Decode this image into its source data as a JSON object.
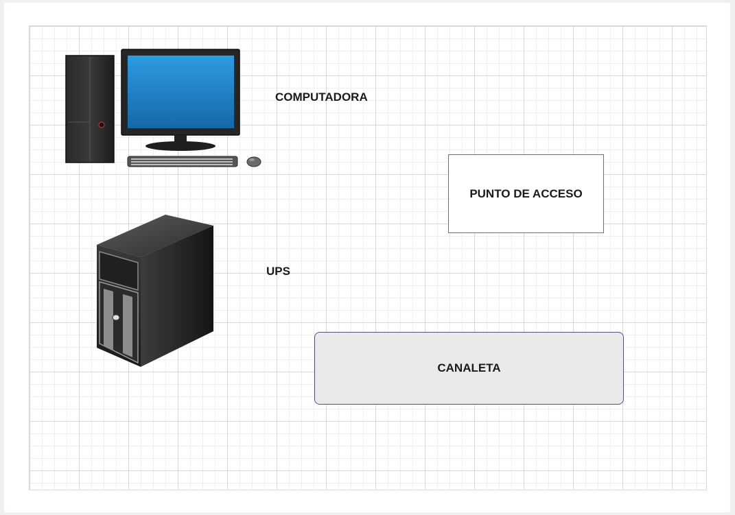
{
  "diagram": {
    "nodes": [
      {
        "id": "computadora",
        "label": "COMPUTADORA",
        "icon": "desktop-computer-icon"
      },
      {
        "id": "ups",
        "label": "UPS",
        "icon": "ups-tower-icon"
      },
      {
        "id": "punto_acceso",
        "label": "PUNTO DE ACCESO",
        "shape": "rectangle"
      },
      {
        "id": "canaleta",
        "label": "CANALETA",
        "shape": "rounded-rectangle"
      }
    ]
  },
  "colors": {
    "monitor_screen": "#1f87c9",
    "box_border": "#6e6a9a",
    "canaleta_fill": "#eaeaea"
  }
}
